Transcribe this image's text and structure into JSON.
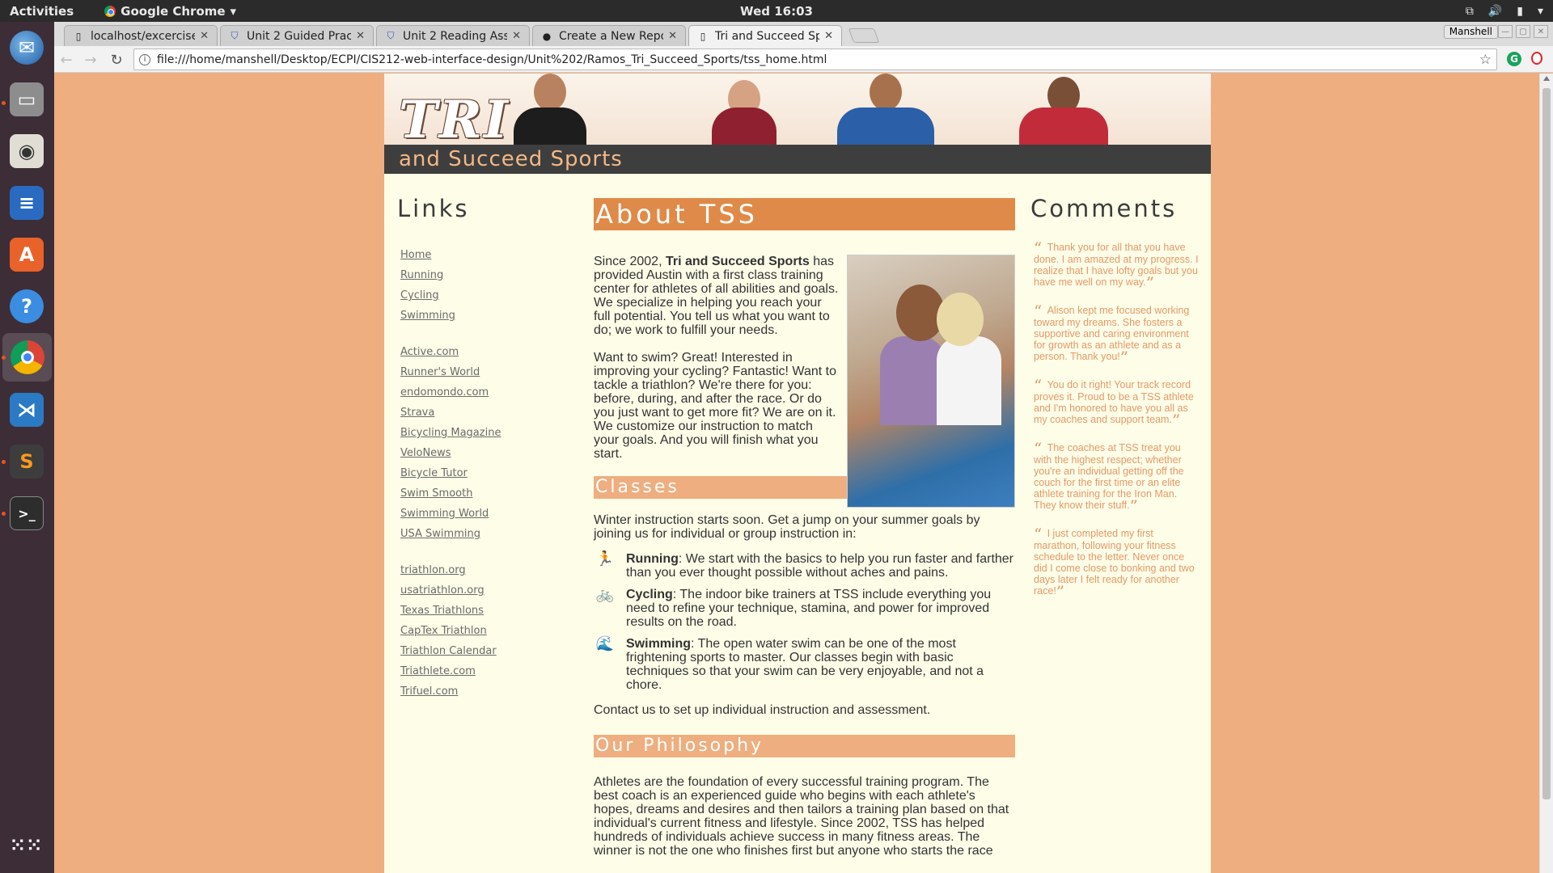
{
  "system": {
    "activities": "Activities",
    "app_name": "Google Chrome",
    "clock": "Wed 16:03"
  },
  "browser": {
    "tabs": [
      {
        "title": "localhost/excercise",
        "icon": "doc-icon"
      },
      {
        "title": "Unit 2 Guided Pract",
        "icon": "shield-icon"
      },
      {
        "title": "Unit 2 Reading Assi",
        "icon": "shield-icon"
      },
      {
        "title": "Create a New Repo",
        "icon": "github-icon"
      },
      {
        "title": "Tri and Succeed Spo",
        "icon": "doc-icon"
      }
    ],
    "profile": "Manshell",
    "url": "file:///home/manshell/Desktop/ECPI/CIS212-web-interface-design/Unit%202/Ramos_Tri_Succeed_Sports/tss_home.html"
  },
  "page": {
    "logo": "TRI",
    "tagline": "and Succeed Sports",
    "links_heading": "Links",
    "links_group1": [
      "Home",
      "Running",
      "Cycling",
      "Swimming"
    ],
    "links_group2": [
      "Active.com",
      "Runner's World",
      "endomondo.com",
      "Strava",
      "Bicycling Magazine",
      "VeloNews",
      "Bicycle Tutor",
      "Swim Smooth",
      "Swimming World",
      "USA Swimming"
    ],
    "links_group3": [
      "triathlon.org",
      "usatriathlon.org",
      "Texas Triathlons",
      "CapTex Triathlon",
      "Triathlon Calendar",
      "Triathlete.com",
      "Trifuel.com"
    ],
    "about_heading": "About TSS",
    "about_p1_pre": "Since 2002, ",
    "about_p1_bold": "Tri and Succeed Sports",
    "about_p1_post": " has provided Austin with a first class training center for athletes of all abilities and goals. We specialize in helping you reach your full potential. You tell us what you want to do; we work to fulfill your needs.",
    "about_p2": "Want to swim? Great! Interested in improving your cycling? Fantastic! Want to tackle a triathlon? We're there for you: before, during, and after the race. Or do you just want to get more fit? We are on it. We customize our instruction to match your goals. And you will finish what you start.",
    "classes_heading": "Classes",
    "classes_intro": "Winter instruction starts soon. Get a jump on your summer goals by joining us for individual or group instruction in:",
    "classes": [
      {
        "name": "Running",
        "text": ": We start with the basics to help you run faster and farther than you ever thought possible without aches and pains.",
        "icon": "running-icon"
      },
      {
        "name": "Cycling",
        "text": ": The indoor bike trainers at TSS include everything you need to refine your technique, stamina, and power for improved results on the road.",
        "icon": "bicycle-icon"
      },
      {
        "name": "Swimming",
        "text": ": The open water swim can be one of the most frightening sports to master. Our classes begin with basic techniques so that your swim can be very enjoyable, and not a chore.",
        "icon": "swimming-icon"
      }
    ],
    "contact": "Contact us to set up individual instruction and assessment.",
    "philosophy_heading": "Our Philosophy",
    "philosophy_text": "Athletes are the foundation of every successful training program. The best coach is an experienced guide who begins with each athlete's hopes, dreams and desires and then tailors a training plan based on that individual's current fitness and lifestyle. Since 2002, TSS has helped hundreds of individuals achieve success in many fitness areas. The winner is not the one who finishes first but anyone who starts the race",
    "comments_heading": "Comments",
    "comments": [
      "Thank you for all that you have done. I am amazed at my progress. I realize that I have lofty goals but you have me well on my way.",
      "Alison kept me focused working toward my dreams. She fosters a supportive and caring environment for growth as an athlete and as a person. Thank you!",
      "You do it right! Your track record proves it. Proud to be a TSS athlete and I'm honored to have you all as my coaches and support team.",
      "The coaches at TSS treat you with the highest respect; whether you're an individual getting off the couch for the first time or an elite athlete training for the Iron Man. They know their stuff.",
      "I just completed my first marathon, following your fitness schedule to the letter. Never once did I come close to bonking and two days later I felt ready for another race!"
    ]
  },
  "colors": {
    "background": "#eeae7f",
    "accent": "#e08a49",
    "comment_text": "#e59966",
    "page_bg": "#fdfde8"
  }
}
